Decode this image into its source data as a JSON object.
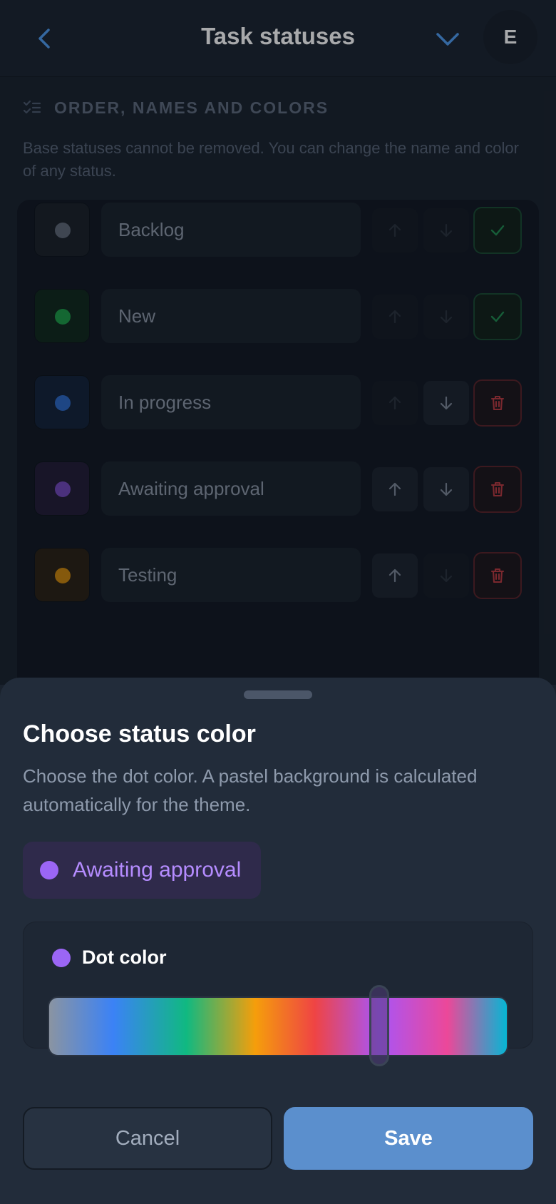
{
  "header": {
    "title": "Task statuses",
    "avatar_initial": "E",
    "icons": {
      "back": "chevron-left-icon",
      "collapse": "chevron-down-icon"
    },
    "accent_color": "#4f9cf0"
  },
  "section": {
    "icon": "checklist-icon",
    "title": "ORDER, NAMES AND COLORS",
    "description": "Base statuses cannot be removed. You can change the name and color of any status."
  },
  "statuses": [
    {
      "name": "Backlog",
      "dot_color": "#5e6775",
      "swatch_bg": "#1b2129",
      "can_up": false,
      "can_down": false,
      "action": "check-icon"
    },
    {
      "name": "New",
      "dot_color": "#1c9a46",
      "swatch_bg": "#10281d",
      "can_up": false,
      "can_down": false,
      "action": "check-icon"
    },
    {
      "name": "In progress",
      "dot_color": "#2c68c4",
      "swatch_bg": "#13223a",
      "can_up": false,
      "can_down": true,
      "action": "trash-icon"
    },
    {
      "name": "Awaiting approval",
      "dot_color": "#7147b8",
      "swatch_bg": "#221c36",
      "can_up": true,
      "can_down": true,
      "action": "trash-icon"
    },
    {
      "name": "Testing",
      "dot_color": "#c9840b",
      "swatch_bg": "#2a2114",
      "can_up": true,
      "can_down": false,
      "action": "trash-icon"
    }
  ],
  "sheet": {
    "title": "Choose status color",
    "description": "Choose the dot color. A pastel background is calculated automatically for the theme.",
    "preview_label": "Awaiting approval",
    "preview_dot_color": "#9b66f5",
    "dot_color_label": "Dot color",
    "hue_position": 0.72,
    "cancel_label": "Cancel",
    "save_label": "Save"
  }
}
